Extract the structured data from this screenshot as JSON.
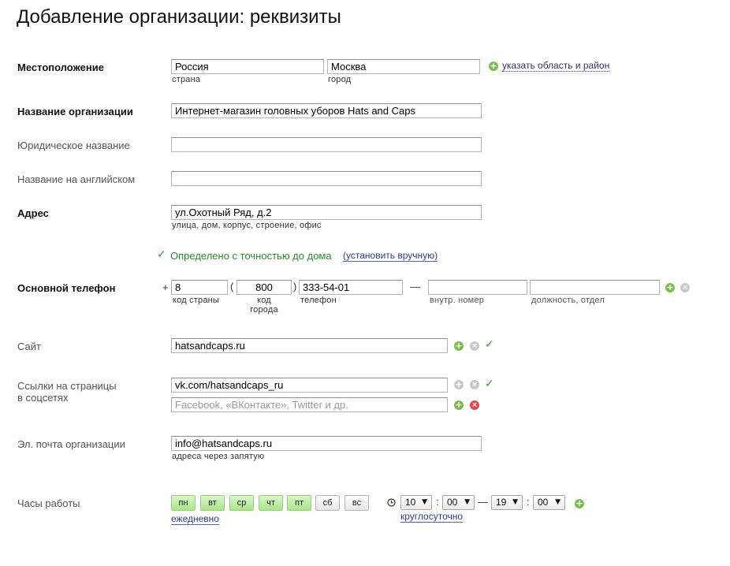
{
  "page": {
    "title": "Добавление организации: реквизиты"
  },
  "location": {
    "label": "Местоположение",
    "country_value": "Россия",
    "country_hint": "страна",
    "city_value": "Москва",
    "city_hint": "город",
    "region_link": "указать область и район"
  },
  "org_name": {
    "label": "Название организации",
    "value": "Интернет-магазин головных уборов Hats and Caps"
  },
  "legal_name": {
    "label": "Юридическое название",
    "value": ""
  },
  "english_name": {
    "label": "Название на английском",
    "value": ""
  },
  "address": {
    "label": "Адрес",
    "value": "ул.Охотный Ряд, д.2",
    "hint": "улица, дом, корпус, строение, офис",
    "status_text": "Определено с точностью до дома",
    "manual_link": "(установить вручную)"
  },
  "phone": {
    "label": "Основной телефон",
    "plus": "+",
    "country_code": "8",
    "country_hint": "код страны",
    "open_paren": "(",
    "city_code": "800",
    "close_paren": ")",
    "city_hint_1": "код",
    "city_hint_2": "города",
    "number": "333-54-01",
    "number_hint": "телефон",
    "dash": "—",
    "extension": "",
    "extension_hint": "внутр. номер",
    "position": "",
    "position_hint": "должность, отдел"
  },
  "site": {
    "label": "Сайт",
    "value": "hatsandcaps.ru"
  },
  "social": {
    "label_1": "Ссылки на страницы",
    "label_2": "в соцсетях",
    "value": "vk.com/hatsandcaps_ru",
    "placeholder": "Facebook, «ВКонтакте», Twitter и др."
  },
  "email": {
    "label": "Эл. почта организации",
    "value": "info@hatsandcaps.ru",
    "hint": "адреса через запятую"
  },
  "hours": {
    "label": "Часы работы",
    "days": [
      {
        "label": "пн",
        "active": true
      },
      {
        "label": "вт",
        "active": true
      },
      {
        "label": "ср",
        "active": true
      },
      {
        "label": "чт",
        "active": true
      },
      {
        "label": "пт",
        "active": true
      },
      {
        "label": "сб",
        "active": false
      },
      {
        "label": "вс",
        "active": false
      }
    ],
    "daily_link": "ежедневно",
    "from_hour": "10",
    "from_min": "00",
    "colon": ":",
    "dash": "—",
    "to_hour": "19",
    "to_min": "00",
    "round_clock_link": "круглосуточно"
  },
  "icons": {
    "add": "plus-circle-icon",
    "remove": "x-circle-icon",
    "ok": "check-icon",
    "clock": "clock-icon"
  },
  "colors": {
    "green": "#7bbd4a",
    "red": "#e24b4b",
    "gray": "#c9c9c9",
    "day_active": "#b8eb9c",
    "check": "#2b9a2b"
  }
}
